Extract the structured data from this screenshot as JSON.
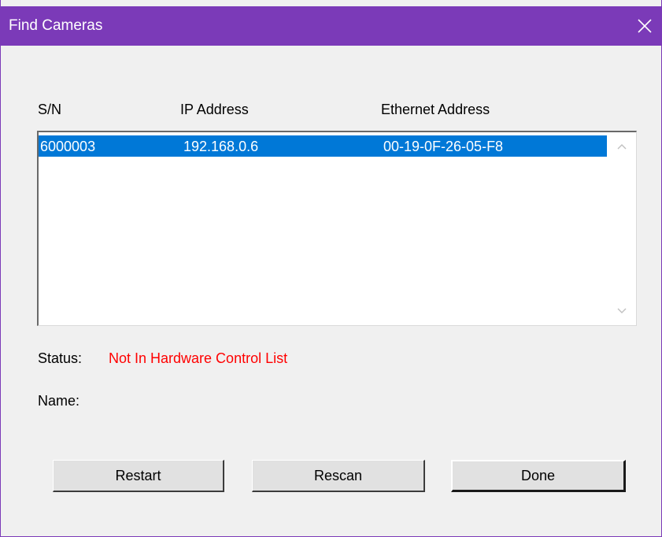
{
  "window": {
    "title": "Find Cameras",
    "accent_color": "#7b3ab8",
    "close_icon": "close-icon"
  },
  "columns": {
    "sn": "S/N",
    "ip": "IP Address",
    "ethernet": "Ethernet Address"
  },
  "cameras": [
    {
      "sn": "6000003",
      "ip": "192.168.0.6",
      "ethernet": "00-19-0F-26-05-F8",
      "selected": true
    }
  ],
  "selection_color": "#0078d7",
  "status": {
    "label": "Status:",
    "value": "Not In Hardware Control List",
    "value_color": "#ff0000"
  },
  "name": {
    "label": "Name:",
    "value": ""
  },
  "buttons": {
    "restart": "Restart",
    "rescan": "Rescan",
    "done": "Done"
  }
}
